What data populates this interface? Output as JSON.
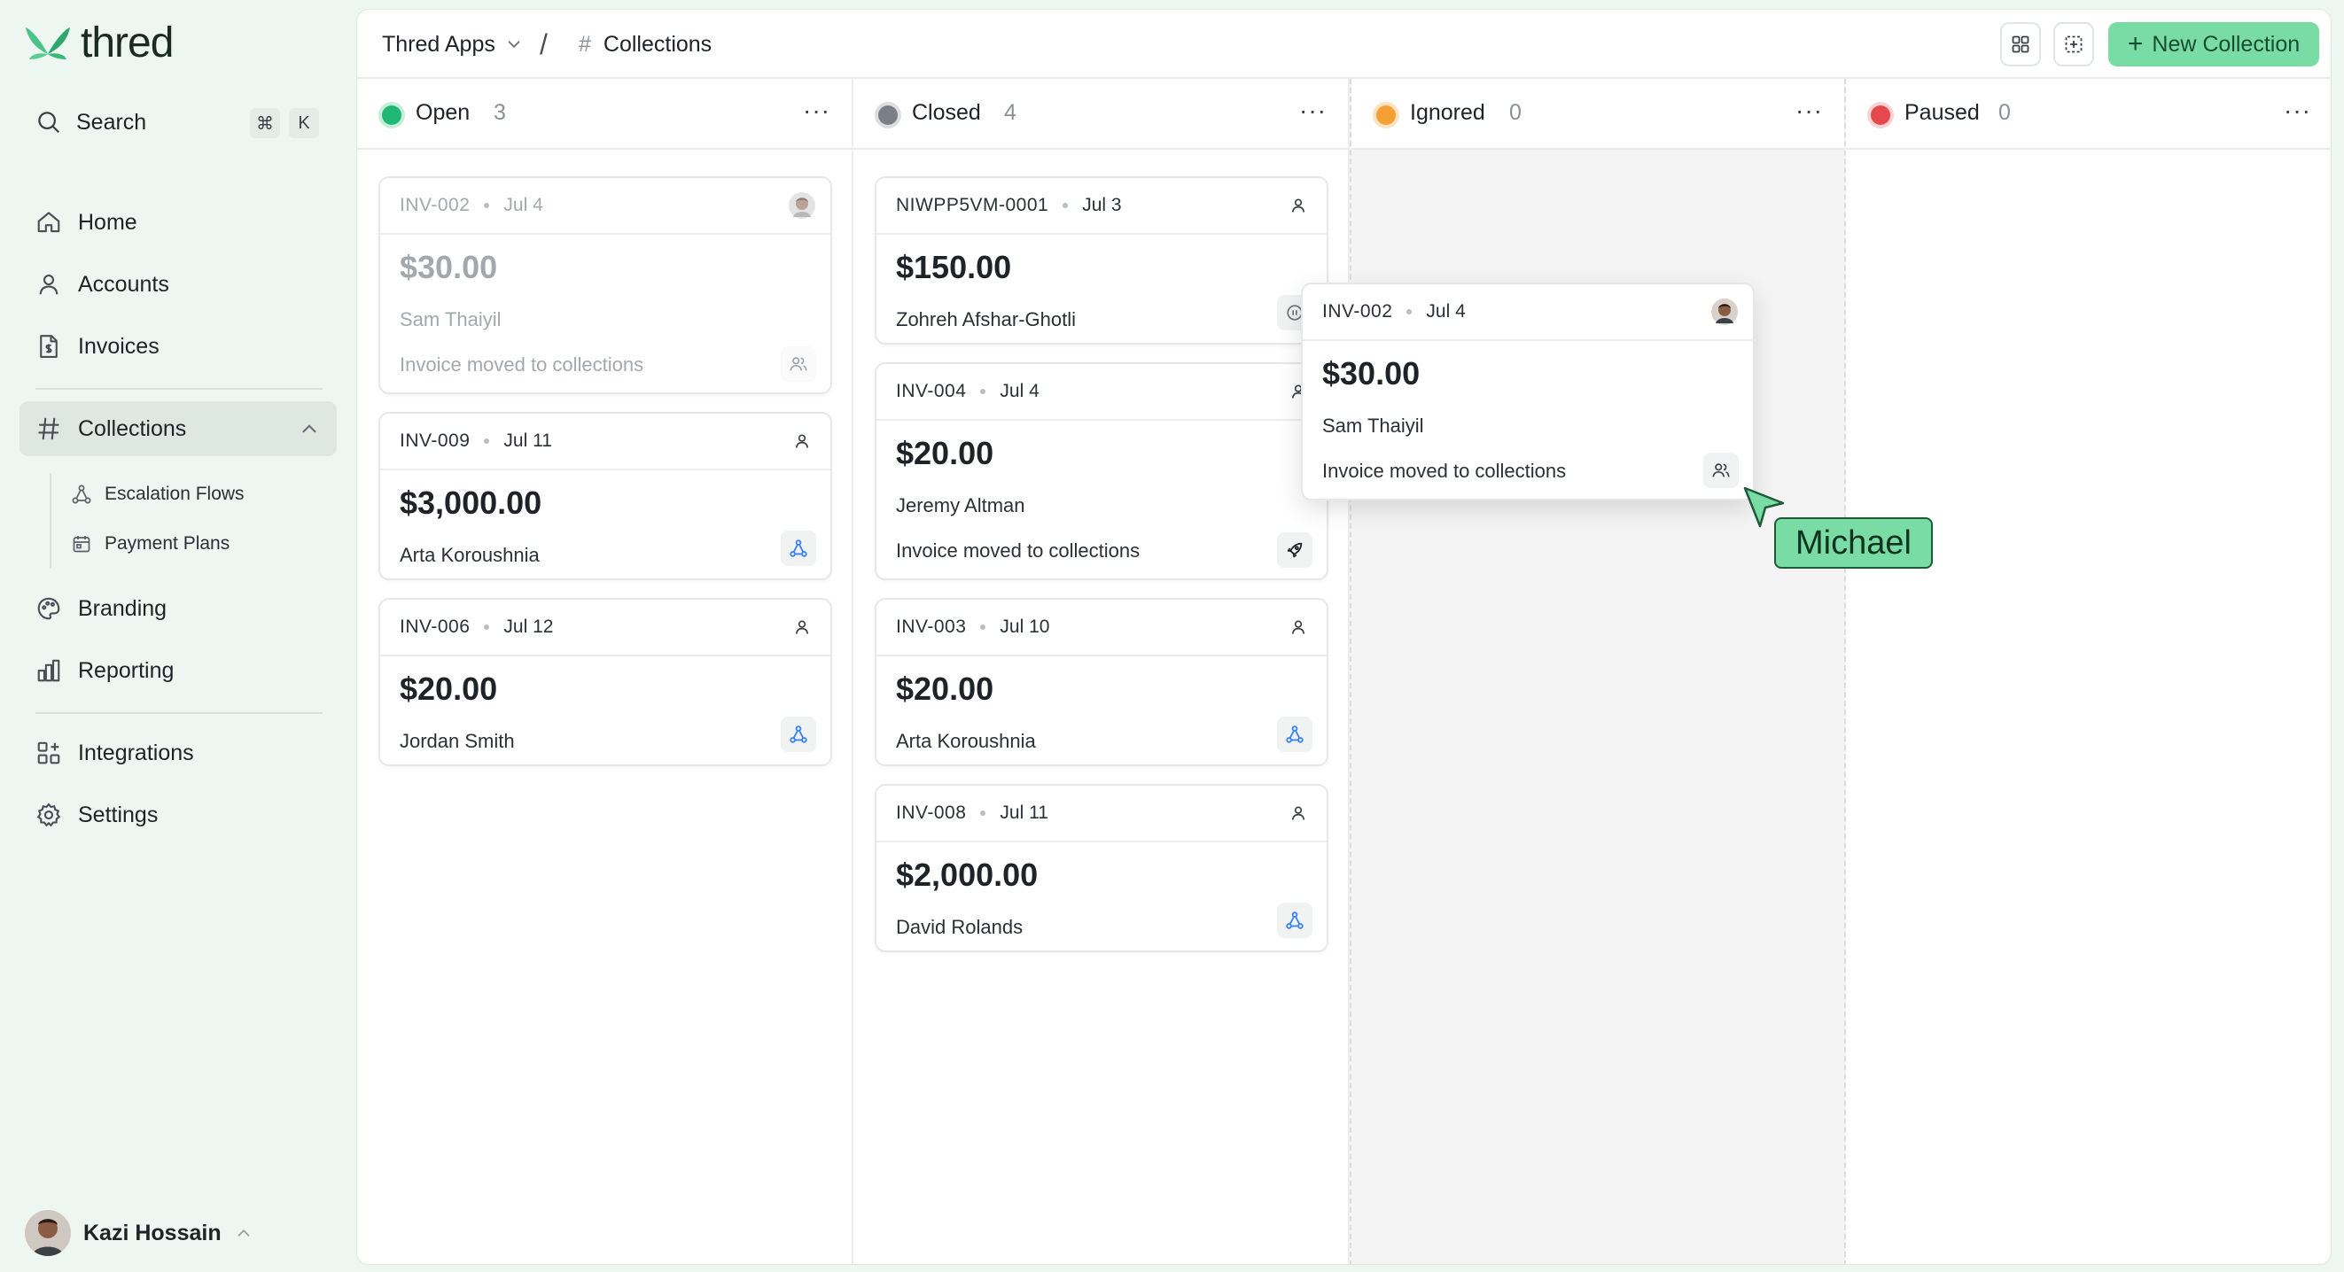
{
  "app": {
    "name": "thred"
  },
  "sidebar": {
    "search": {
      "label": "Search",
      "kbd_cmd": "⌘",
      "kbd_key": "K"
    },
    "nav": [
      {
        "label": "Home",
        "icon": "home-icon"
      },
      {
        "label": "Accounts",
        "icon": "user-icon"
      },
      {
        "label": "Invoices",
        "icon": "invoice-icon"
      },
      {
        "label": "Collections",
        "icon": "hash-icon",
        "active": true,
        "expanded": true
      },
      {
        "label": "Branding",
        "icon": "palette-icon"
      },
      {
        "label": "Reporting",
        "icon": "bar-chart-icon"
      },
      {
        "label": "Integrations",
        "icon": "integrations-icon"
      },
      {
        "label": "Settings",
        "icon": "gear-icon"
      }
    ],
    "collections_sub": [
      {
        "label": "Escalation Flows",
        "icon": "flow-icon"
      },
      {
        "label": "Payment Plans",
        "icon": "calendar-icon"
      }
    ],
    "user": {
      "name": "Kazi Hossain"
    }
  },
  "header": {
    "workspace": "Thred Apps",
    "separator": "/",
    "page_hash": "#",
    "page": "Collections",
    "new_button": "New Collection",
    "new_button_plus": "+"
  },
  "colors": {
    "accent": "#79dca5",
    "open": "#1fb874",
    "closed": "#7b8088",
    "ignored": "#f5a035",
    "paused": "#e5484d"
  },
  "columns": [
    {
      "title": "Open",
      "count": "3",
      "status": "open",
      "cards": [
        {
          "id": "INV-002",
          "date": "Jul 4",
          "amount": "$30.00",
          "name": "Sam Thaiyil",
          "note": "Invoice moved to collections",
          "owner": "avatar",
          "action": "users-icon",
          "faded": true
        },
        {
          "id": "INV-009",
          "date": "Jul 11",
          "amount": "$3,000.00",
          "name": "Arta Koroushnia",
          "owner": "user-icon",
          "action": "flow-icon"
        },
        {
          "id": "INV-006",
          "date": "Jul 12",
          "amount": "$20.00",
          "name": "Jordan Smith",
          "owner": "user-icon",
          "action": "flow-icon"
        }
      ]
    },
    {
      "title": "Closed",
      "count": "4",
      "status": "closed",
      "cards": [
        {
          "id": "NIWPP5VM-0001",
          "date": "Jul 3",
          "amount": "$150.00",
          "name": "Zohreh Afshar-Ghotli",
          "owner": "user-icon",
          "action": "pause-icon"
        },
        {
          "id": "INV-004",
          "date": "Jul 4",
          "amount": "$20.00",
          "name": "Jeremy Altman",
          "note": "Invoice moved to collections",
          "owner": "user-icon",
          "action": "rocket-icon"
        },
        {
          "id": "INV-003",
          "date": "Jul 10",
          "amount": "$20.00",
          "name": "Arta Koroushnia",
          "owner": "user-icon",
          "action": "flow-icon"
        },
        {
          "id": "INV-008",
          "date": "Jul 11",
          "amount": "$2,000.00",
          "name": "David Rolands",
          "owner": "user-icon",
          "action": "flow-icon"
        }
      ]
    },
    {
      "title": "Ignored",
      "count": "0",
      "status": "ignored",
      "cards": []
    },
    {
      "title": "Paused",
      "count": "0",
      "status": "paused",
      "cards": []
    }
  ],
  "dragging_card": {
    "id": "INV-002",
    "date": "Jul 4",
    "amount": "$30.00",
    "name": "Sam Thaiyil",
    "note": "Invoice moved to collections"
  },
  "cursor": {
    "label": "Michael"
  }
}
